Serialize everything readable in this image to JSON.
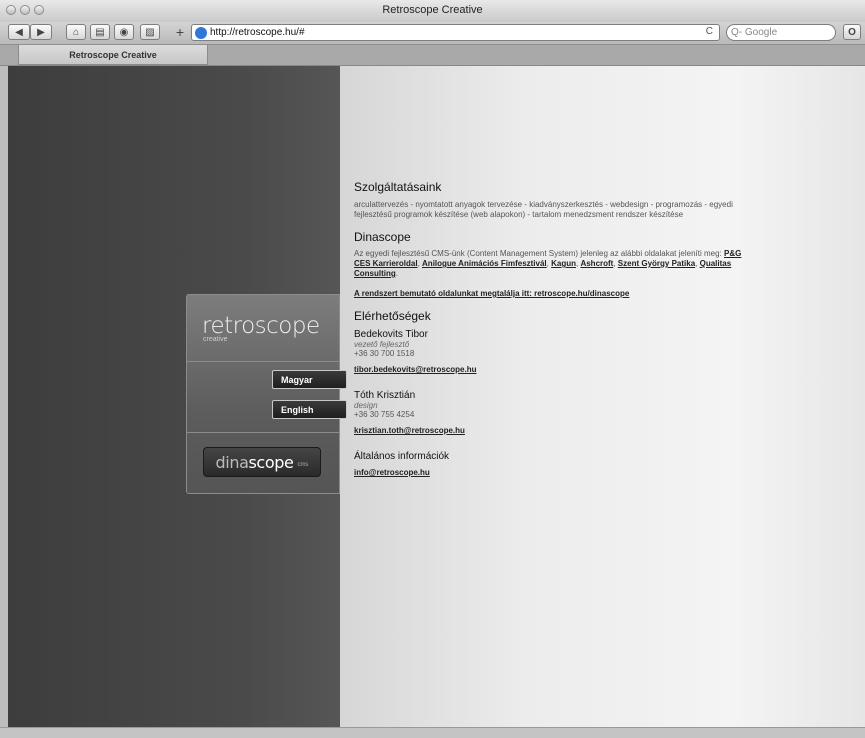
{
  "window": {
    "title": "Retroscope Creative"
  },
  "toolbar": {
    "url": "http://retroscope.hu/#",
    "reload_glyph": "C",
    "search_placeholder": "Q- Google",
    "back_icon": "back-arrow-icon",
    "forward_icon": "forward-arrow-icon",
    "home_icon": "home-icon",
    "print_icon": "print-icon",
    "info_icon": "info-icon",
    "screenshot_icon": "image-icon",
    "add_icon": "plus-icon",
    "add_label": "+",
    "tab_label": "Retroscope Creative"
  },
  "sidebar": {
    "logo_text": "retroscope",
    "logo_sub": "creative",
    "lang_hu": "Magyar",
    "lang_en": "English",
    "dina_part1": "dina",
    "dina_part2": "scope",
    "dina_cms": "cms"
  },
  "services": {
    "title": "Szolgáltatásaink",
    "text": "arculattervezés - nyomtatott anyagok tervezése - kiadványszerkesztés - webdesign - programozás - egyedi fejlesztésű programok készítése (web alapokon) - tartalom menedzsment rendszer készítése"
  },
  "dinascope": {
    "title": "Dinascope",
    "intro": "Az egyedi fejlesztésű CMS-ünk (Content Management System) jelenleg az alábbi oldalakat jeleníti meg:",
    "links": [
      "P&G CES Karrieroldal",
      "Anilogue Animációs Fimfesztivál",
      "Kagun",
      "Ashcroft",
      "Szent György Patika",
      "Qualitas Consulting"
    ],
    "demo_link": "A rendszert bemutató oldalunkat megtalálja itt: retroscope.hu/dinascope"
  },
  "contacts": {
    "title": "Elérhetőségek",
    "people": [
      {
        "name": "Bedekovits Tibor",
        "role": "vezető fejlesztő",
        "phone": "+36 30 700 1518",
        "email": "tibor.bedekovits@retroscope.hu"
      },
      {
        "name": "Tóth Krisztián",
        "role": "design",
        "phone": "+36 30 755 4254",
        "email": "krisztian.toth@retroscope.hu"
      }
    ],
    "general_title": "Általános információk",
    "general_email": "info@retroscope.hu"
  },
  "colors": {
    "left_panel": "#424242",
    "right_panel": "#efefef",
    "accent_link": "#222222"
  }
}
